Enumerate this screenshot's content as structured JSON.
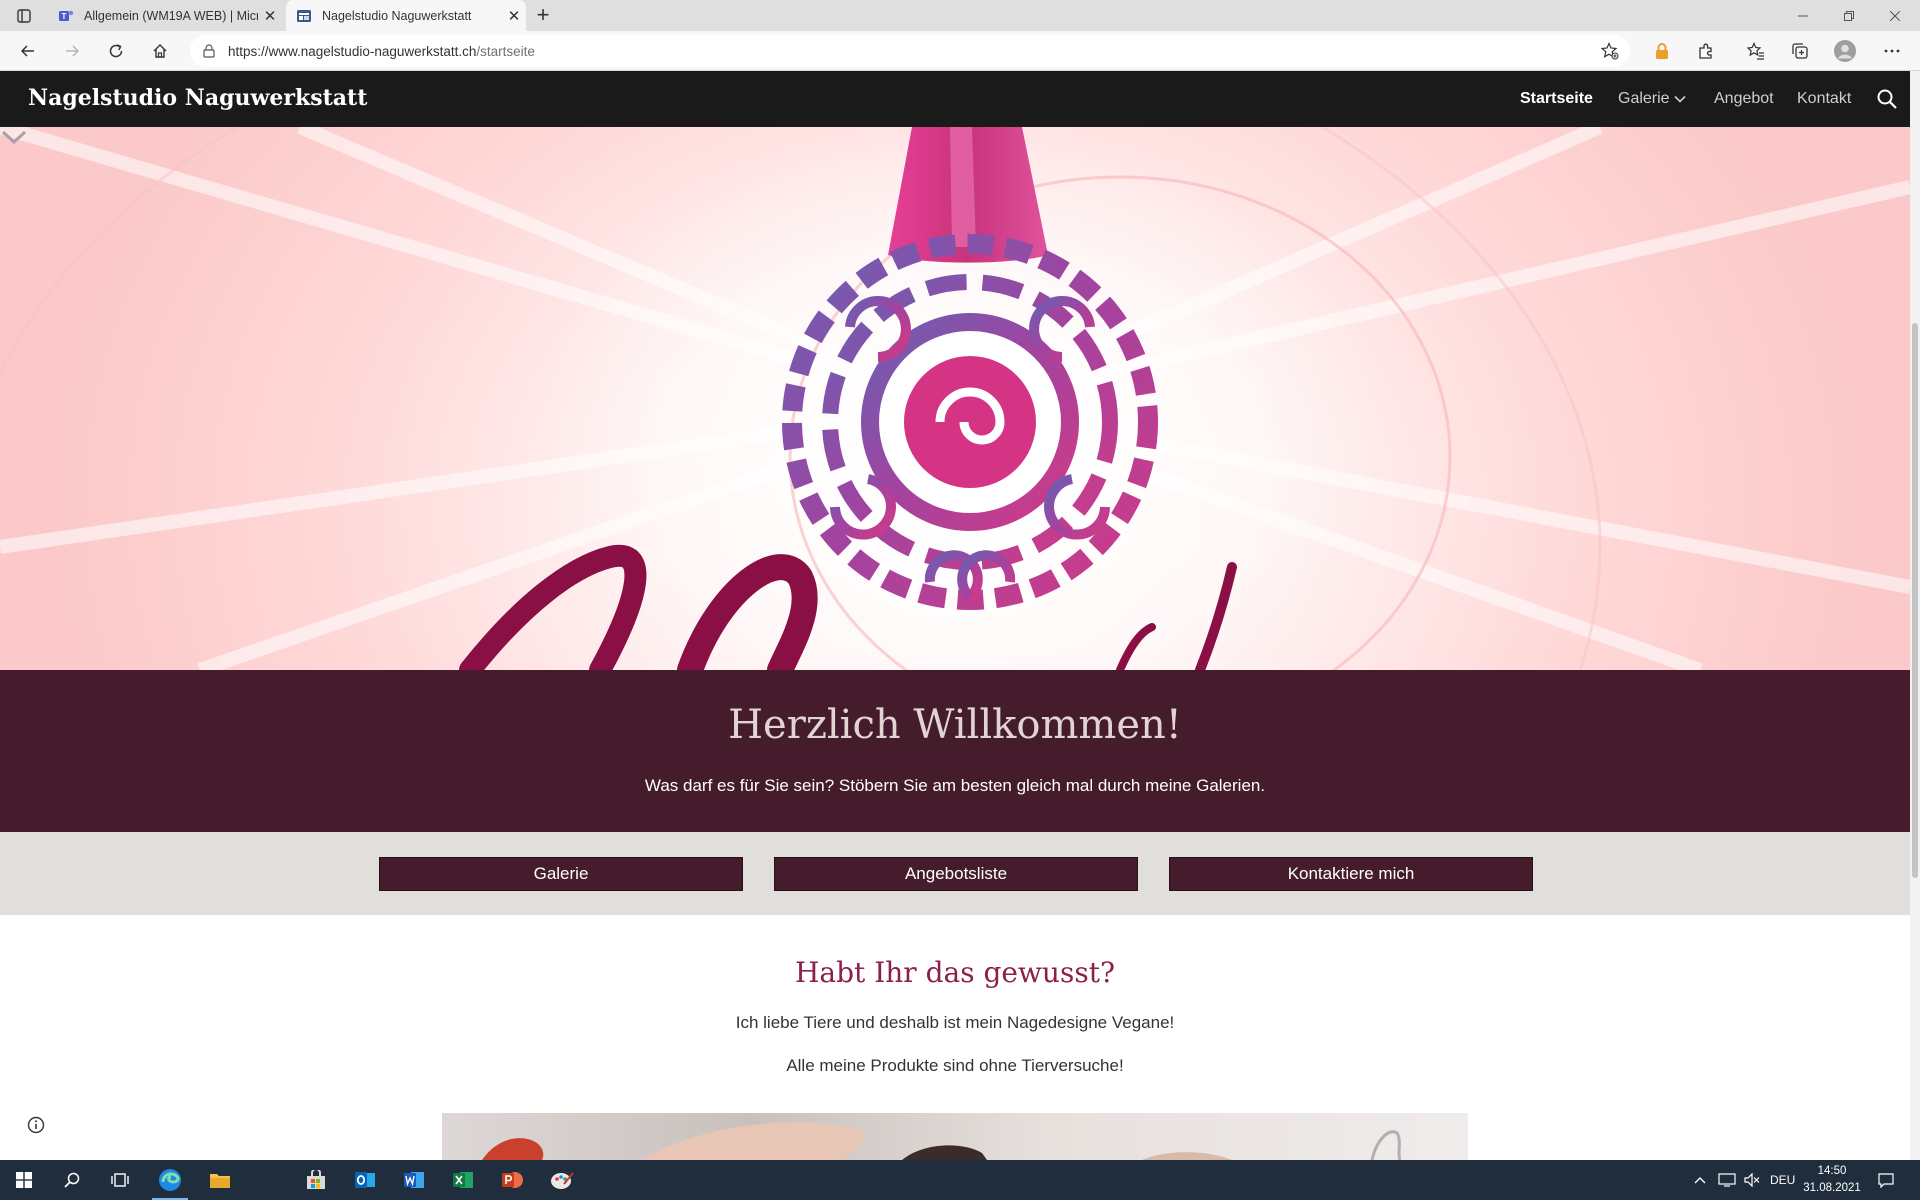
{
  "browser": {
    "tabs": [
      {
        "title": "Allgemein (WM19A WEB) | Micro",
        "icon": "teams-icon",
        "active": false
      },
      {
        "title": "Nagelstudio Naguwerkstatt",
        "icon": "site-page-icon",
        "active": true
      }
    ],
    "url_host": "https://www.nagelstudio-naguwerkstatt.ch",
    "url_path": "/startseite"
  },
  "site": {
    "brand": "Nagelstudio Naguwerkstatt",
    "nav": [
      {
        "label": "Startseite",
        "active": true
      },
      {
        "label": "Galerie",
        "has_dropdown": true
      },
      {
        "label": "Angebot"
      },
      {
        "label": "Kontakt"
      }
    ]
  },
  "welcome": {
    "title": "Herzlich Willkommen!",
    "text": "Was darf es für Sie sein? Stöbern Sie am besten gleich mal durch meine Galerien."
  },
  "buttons": {
    "galerie": "Galerie",
    "angebotsliste": "Angebotsliste",
    "kontakt": "Kontaktiere mich"
  },
  "info": {
    "title": "Habt Ihr das gewusst?",
    "line1": "Ich liebe Tiere und deshalb ist mein Nagedesigne Vegane!",
    "line2": "Alle meine Produkte sind ohne Tierversuche!"
  },
  "taskbar": {
    "language": "DEU",
    "time": "14:50",
    "date": "31.08.2021"
  },
  "colors": {
    "brand_dark": "#451c2b",
    "accent_title": "#8c1f4c",
    "nav_bg": "#1a1a1a",
    "band_grey": "#e1dfdc"
  }
}
